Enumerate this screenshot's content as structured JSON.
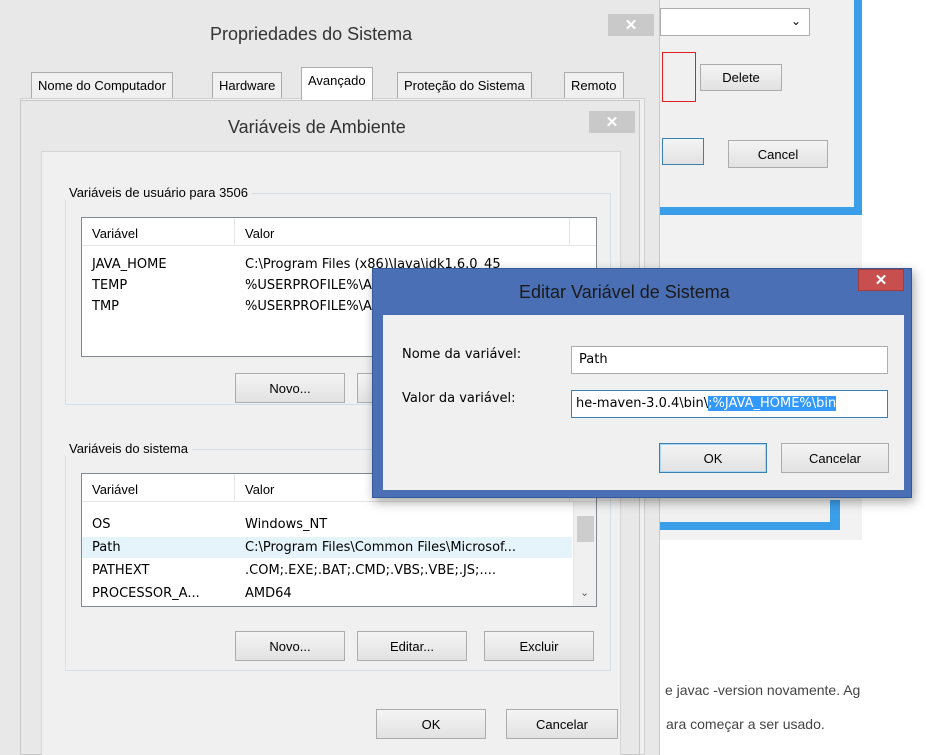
{
  "colors": {
    "window_bg": "#f0f0f0",
    "frame_light": "#e8e8e8",
    "close_red": "#c7504f",
    "close_inactive": "#c9c9c9",
    "win8_blue": "#4a6fb5",
    "selection": "#3399ff",
    "highlight_row": "#e5f3fb"
  },
  "background": {
    "delete_label": "Delete",
    "cancel_label": "Cancel",
    "text_line1": "e javac -version novamente. Ag",
    "text_line2": "ara começar a ser usado."
  },
  "system_properties": {
    "title": "Propriedades do Sistema",
    "close_icon": "close-icon",
    "tabs": [
      {
        "label": "Nome do Computador"
      },
      {
        "label": "Hardware"
      },
      {
        "label": "Avançado"
      },
      {
        "label": "Proteção do Sistema"
      },
      {
        "label": "Remoto"
      }
    ],
    "active_tab": "Avançado"
  },
  "env_vars": {
    "title": "Variáveis de Ambiente",
    "user_group_label": "Variáveis de usuário para 3506",
    "system_group_label": "Variáveis do sistema",
    "col_variable": "Variável",
    "col_value": "Valor",
    "user_rows": [
      {
        "name": "JAVA_HOME",
        "value": "C:\\Program Files (x86)\\Java\\jdk1.6.0_45"
      },
      {
        "name": "TEMP",
        "value": "%USERPROFILE%\\AppData\\Local\\Temp"
      },
      {
        "name": "TMP",
        "value": "%USERPROFILE%\\AppData\\Local\\Temp"
      }
    ],
    "system_rows": [
      {
        "name": "OS",
        "value": "Windows_NT"
      },
      {
        "name": "Path",
        "value": "C:\\Program Files\\Common Files\\Microsof..."
      },
      {
        "name": "PATHEXT",
        "value": ".COM;.EXE;.BAT;.CMD;.VBS;.VBE;.JS;...."
      },
      {
        "name": "PROCESSOR_A...",
        "value": "AMD64"
      }
    ],
    "new_label": "Novo...",
    "edit_label": "Editar...",
    "delete_label": "Excluir",
    "ok_label": "OK",
    "cancel_label": "Cancelar"
  },
  "edit_var": {
    "title": "Editar Variável de Sistema",
    "name_label": "Nome da variável:",
    "value_label": "Valor da variável:",
    "name_value": "Path",
    "value_plain": "he-maven-3.0.4\\bin\\",
    "value_selected": ";%JAVA_HOME%\\bin",
    "ok_label": "OK",
    "cancel_label": "Cancelar"
  }
}
